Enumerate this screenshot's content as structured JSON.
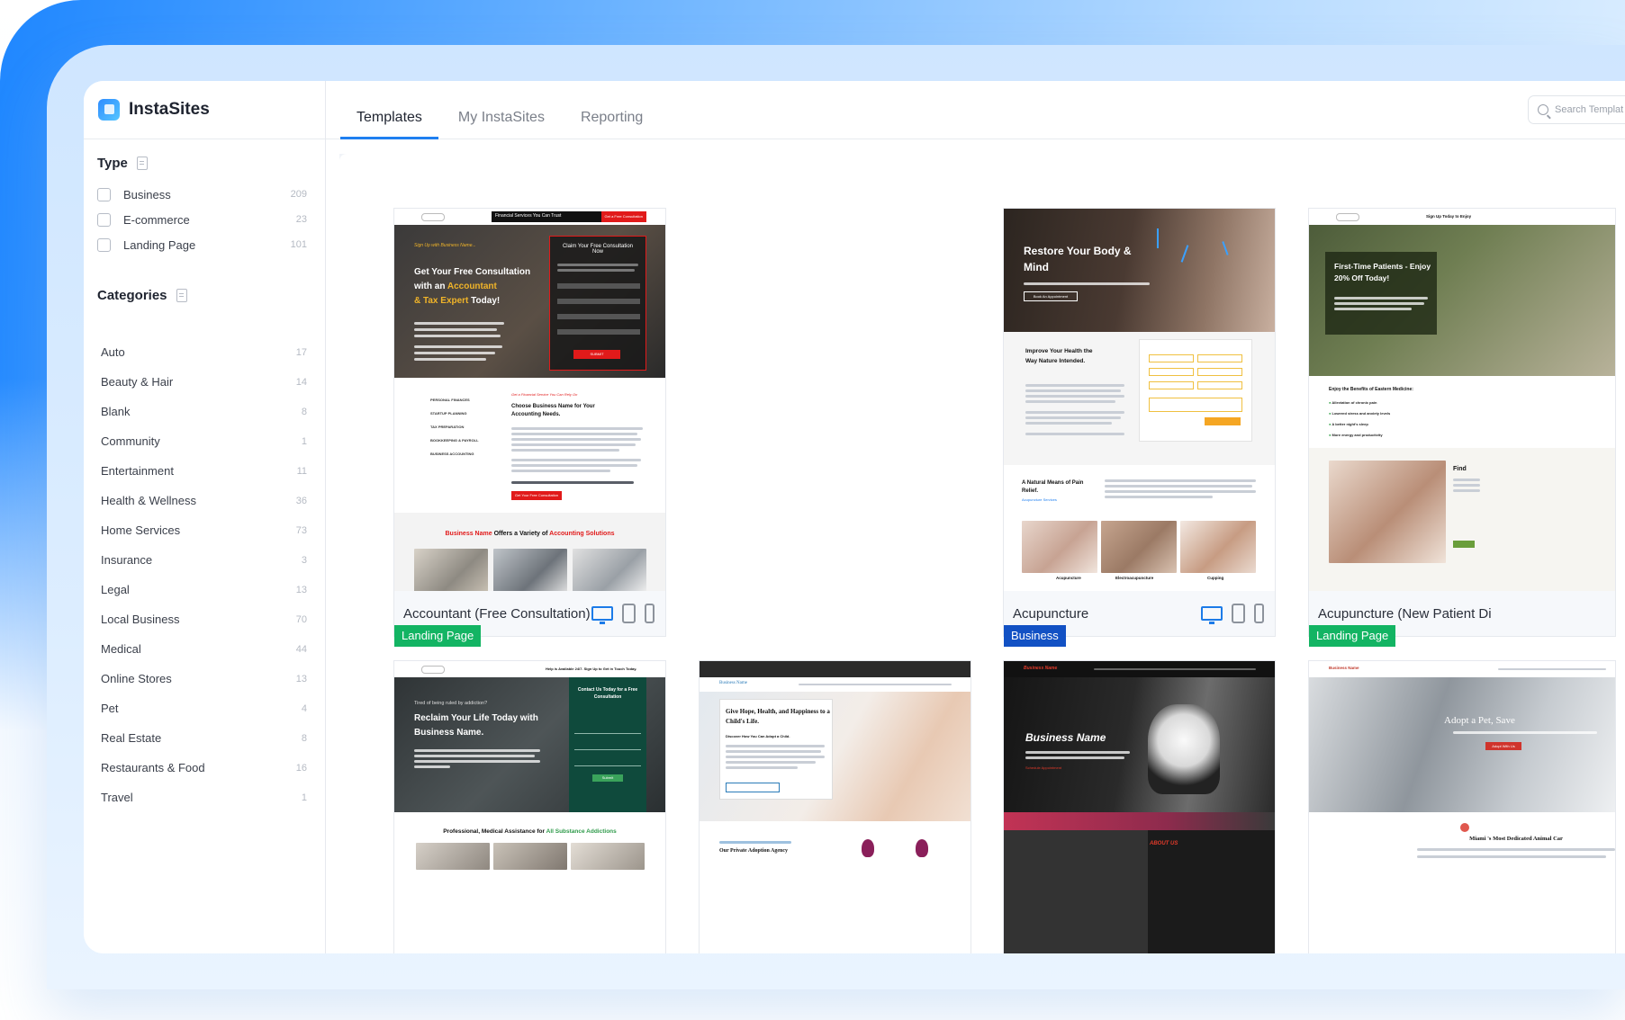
{
  "app": {
    "name": "InstaSites"
  },
  "tabs": [
    {
      "label": "Templates",
      "active": true
    },
    {
      "label": "My InstaSites",
      "active": false
    },
    {
      "label": "Reporting",
      "active": false
    }
  ],
  "search": {
    "placeholder": "Search Templat"
  },
  "sidebar": {
    "type_title": "Type",
    "types": [
      {
        "label": "Business",
        "count": "209"
      },
      {
        "label": "E-commerce",
        "count": "23"
      },
      {
        "label": "Landing Page",
        "count": "101"
      }
    ],
    "categories_title": "Categories",
    "categories": [
      {
        "label": "Auto",
        "count": "17"
      },
      {
        "label": "Beauty & Hair",
        "count": "14"
      },
      {
        "label": "Blank",
        "count": "8"
      },
      {
        "label": "Community",
        "count": "1"
      },
      {
        "label": "Entertainment",
        "count": "11"
      },
      {
        "label": "Health & Wellness",
        "count": "36"
      },
      {
        "label": "Home Services",
        "count": "73"
      },
      {
        "label": "Insurance",
        "count": "3"
      },
      {
        "label": "Legal",
        "count": "13"
      },
      {
        "label": "Local Business",
        "count": "70"
      },
      {
        "label": "Medical",
        "count": "44"
      },
      {
        "label": "Online Stores",
        "count": "13"
      },
      {
        "label": "Pet",
        "count": "4"
      },
      {
        "label": "Real Estate",
        "count": "8"
      },
      {
        "label": "Restaurants & Food",
        "count": "16"
      },
      {
        "label": "Travel",
        "count": "1"
      }
    ]
  },
  "templates": [
    {
      "name": "Accountant (Free Consultation)",
      "badge": "Landing Page",
      "preview": {
        "topbar": "Financial Services You Can Trust",
        "topbar_cta": "Get a Free Consultation",
        "eyebrow": "Sign Up with Business Name...",
        "headline_1": "Get Your Free Consultation",
        "headline_2": "with an ",
        "headline_accent_1": "Accountant",
        "headline_3": "& Tax Expert",
        "headline_4": " Today!",
        "form_title": "Claim Your Free Consultation Now",
        "submit": "SUBMIT",
        "services": [
          "PERSONAL FINANCES",
          "STARTUP PLANNING",
          "TAX PREPARATION",
          "BOOKKEEPING & PAYROLL",
          "BUSINESS ACCOUNTING"
        ],
        "service_eyebrow": "Get a Financial Service You Can Rely On",
        "service_title": "Choose Business Name for Your Accounting Needs.",
        "cta_button": "Get Your Free Consultation",
        "offer_pre": "Business Name",
        "offer_mid": " Offers a Variety of ",
        "offer_accent": "Accounting Solutions"
      }
    },
    {
      "name": "Acupuncture",
      "badge": "Business",
      "preview": {
        "headline": "Restore Your Body & Mind",
        "button": "Book An Appointment",
        "improve_title": "Improve Your Health the Way Nature Intended.",
        "means_title": "A Natural Means of Pain Relief.",
        "means_link": "Acupuncture Services",
        "thumbs": [
          "Acupuncture",
          "Electroacupuncture",
          "Cupping"
        ]
      }
    },
    {
      "name": "Acupuncture (New Patient Di",
      "badge": "Landing Page",
      "preview": {
        "topbar": "Sign Up Today to Enjoy",
        "headline": "First-Time Patients - Enjoy 20% Off Today!",
        "benefits_title": "Enjoy the Benefits of Eastern Medicine:",
        "benefits": [
          "Alleviation of chronic pain",
          "Lowered stress and anxiety levels",
          "A better night's sleep",
          "More energy and productivity"
        ],
        "find": "Find"
      }
    },
    {
      "preview": {
        "topbar": "Help is Available 24/7. Sign Up to Get in Touch Today.",
        "eyebrow": "Tired of being ruled by addiction?",
        "headline": "Reclaim Your Life Today with Business Name.",
        "form_title": "Contact Us Today for a Free Consultation",
        "submit": "Submit",
        "bottom_pre": "Professional, Medical Assistance for ",
        "bottom_accent": "All Substance Addictions"
      }
    },
    {
      "preview": {
        "brand": "Business Name",
        "headline": "Give Hope, Health, and Happiness to a Child's Life.",
        "sub": "Discover How You Can Adopt a Child.",
        "bottom_title": "Our Private Adoption Agency"
      }
    },
    {
      "preview": {
        "brand": "Business Name",
        "headline": "Business Name",
        "link": "Schedule Appointment",
        "about": "ABOUT US"
      }
    },
    {
      "preview": {
        "brand": "Business Name",
        "headline": "Adopt a Pet, Save",
        "button": "Adopt With Us",
        "bottom_title": "Miami 's Most Dedicated Animal Car"
      }
    }
  ],
  "colors": {
    "accent": "#1f7ff0",
    "badge_green": "#13b463",
    "badge_blue": "#1251c4"
  }
}
